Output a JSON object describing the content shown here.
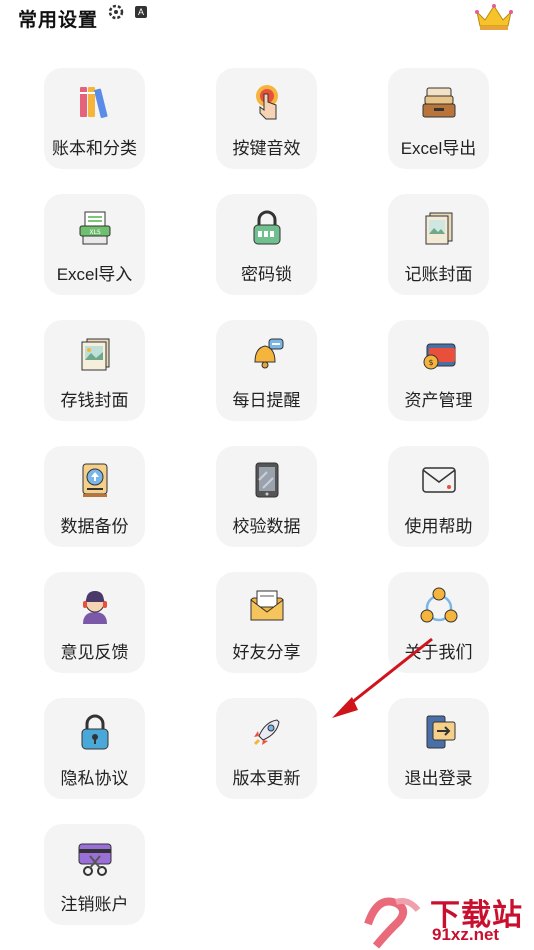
{
  "header": {
    "title": "常用设置"
  },
  "status_icons": [
    "gear-icon",
    "a-badge-icon",
    "crown-icon"
  ],
  "items": [
    {
      "label": "账本和分类",
      "icon": "books-icon"
    },
    {
      "label": "按键音效",
      "icon": "tap-finger-icon"
    },
    {
      "label": "Excel导出",
      "icon": "drawer-export-icon"
    },
    {
      "label": "Excel导入",
      "icon": "xls-printer-icon"
    },
    {
      "label": "密码锁",
      "icon": "padlock-keypad-icon"
    },
    {
      "label": "记账封面",
      "icon": "picture-frame-icon"
    },
    {
      "label": "存钱封面",
      "icon": "photo-card-icon"
    },
    {
      "label": "每日提醒",
      "icon": "bell-message-icon"
    },
    {
      "label": "资产管理",
      "icon": "wallet-coin-icon"
    },
    {
      "label": "数据备份",
      "icon": "backup-box-icon"
    },
    {
      "label": "校验数据",
      "icon": "tablet-icon"
    },
    {
      "label": "使用帮助",
      "icon": "envelope-icon"
    },
    {
      "label": "意见反馈",
      "icon": "headset-agent-icon"
    },
    {
      "label": "好友分享",
      "icon": "mail-share-icon"
    },
    {
      "label": "关于我们",
      "icon": "network-circle-icon"
    },
    {
      "label": "隐私协议",
      "icon": "lock-icon"
    },
    {
      "label": "版本更新",
      "icon": "rocket-icon"
    },
    {
      "label": "退出登录",
      "icon": "logout-screen-icon"
    },
    {
      "label": "注销账户",
      "icon": "card-scissors-icon"
    }
  ],
  "watermark": {
    "brand": "下载站",
    "url": "91xz.net"
  },
  "colors": {
    "card_bg": "#f4f4f5",
    "arrow": "#d0141c",
    "watermark": "#c8102e"
  }
}
